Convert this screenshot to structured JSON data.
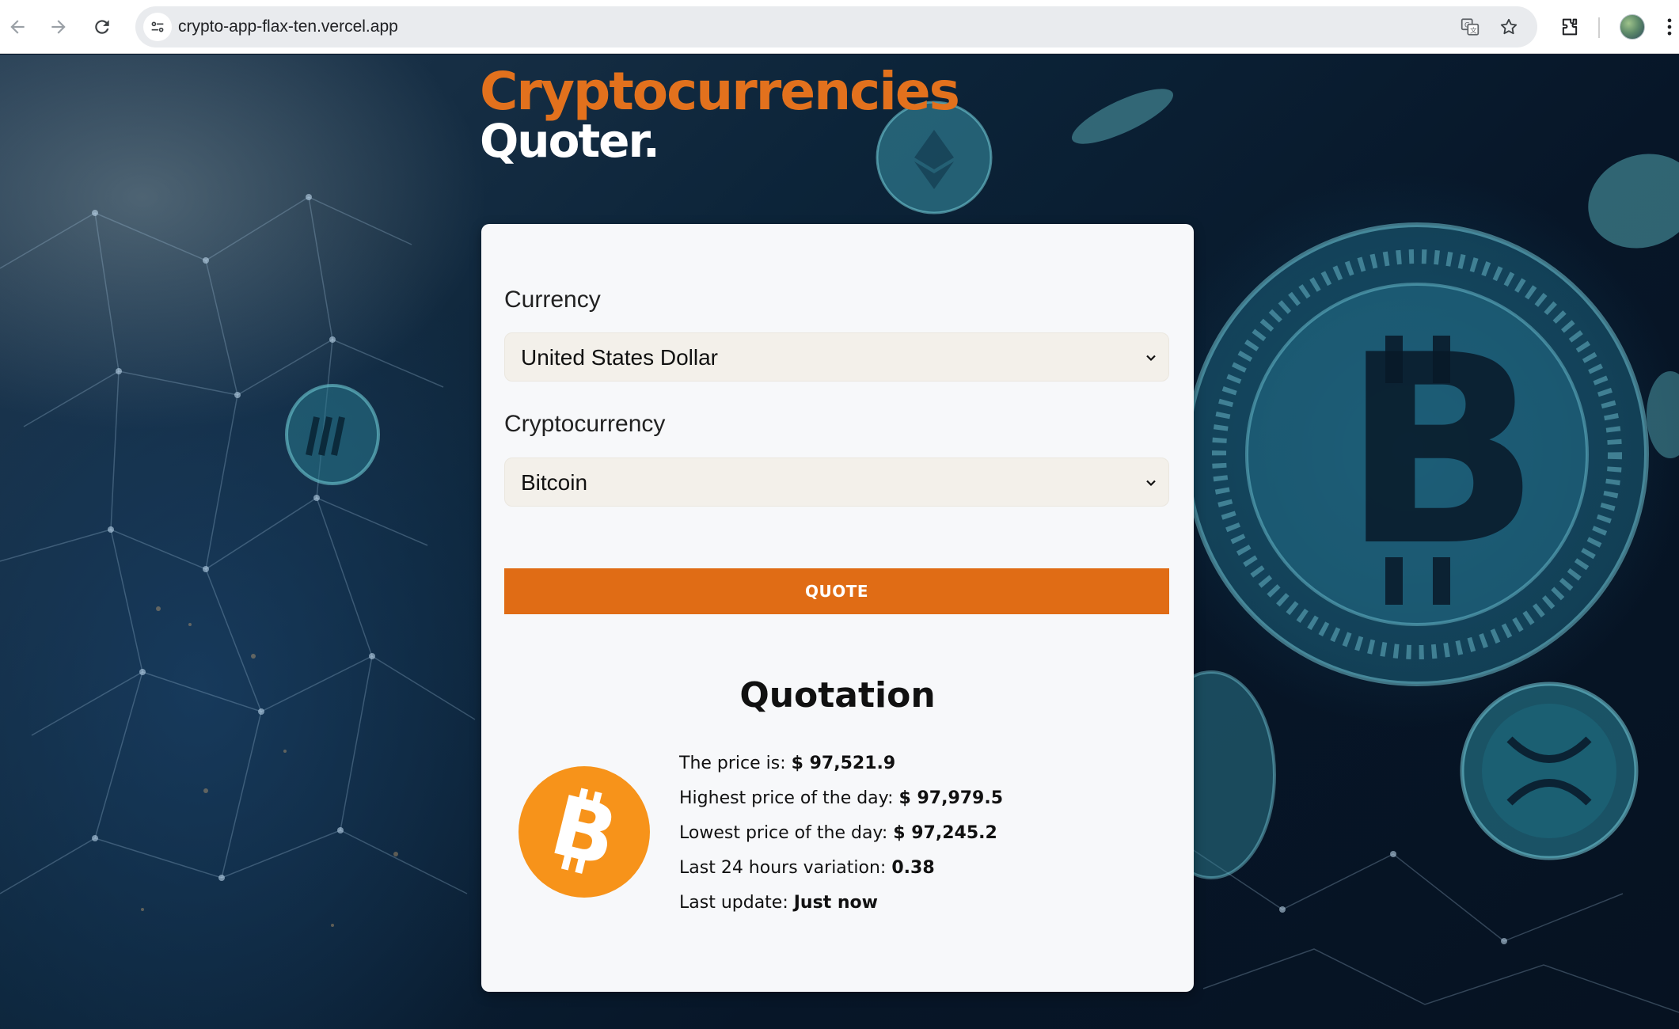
{
  "browser": {
    "url": "crypto-app-flax-ten.vercel.app"
  },
  "header": {
    "title_line1": "Cryptocurrencies",
    "title_line2": "Quoter."
  },
  "form": {
    "currency_label": "Currency",
    "currency_value": "United States Dollar",
    "crypto_label": "Cryptocurrency",
    "crypto_value": "Bitcoin",
    "quote_button": "QUOTE"
  },
  "quotation": {
    "title": "Quotation",
    "coin_icon": "bitcoin-logo",
    "price_label": "The price is:",
    "price_value": "$ 97,521.9",
    "high_label": "Highest price of the day:",
    "high_value": "$ 97,979.5",
    "low_label": "Lowest price of the day:",
    "low_value": "$ 97,245.2",
    "variation_label": "Last 24 hours variation:",
    "variation_value": "0.38",
    "update_label": "Last update:",
    "update_value": "Just now"
  },
  "colors": {
    "accent": "#e06c15",
    "bitcoin": "#f7931a",
    "card_bg": "#f7f8fa"
  }
}
